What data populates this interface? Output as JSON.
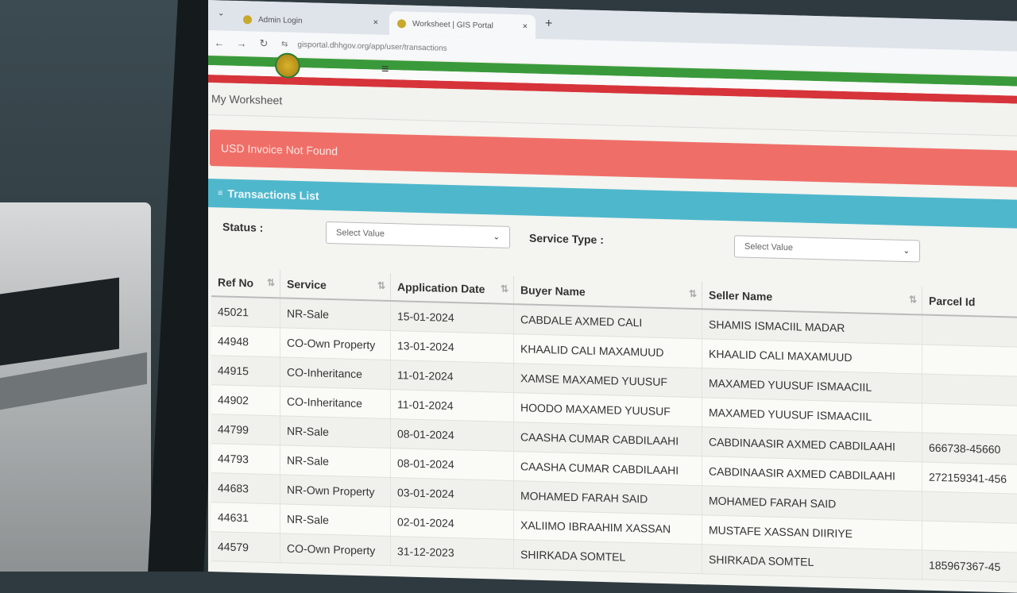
{
  "browser": {
    "tabs": [
      {
        "title": "Admin Login",
        "close": "×"
      },
      {
        "title": "Worksheet | GIS Portal",
        "close": "×"
      }
    ],
    "menu": "⌄",
    "new_tab": "+",
    "url": "gisportal.dhhgov.org/app/user/transactions",
    "nav": {
      "back": "←",
      "forward": "→",
      "reload": "↻",
      "site": "⇆"
    }
  },
  "header": {
    "menu_icon": "≡"
  },
  "page": {
    "title": "My Worksheet",
    "alert": "USD Invoice Not Found",
    "panel_title": "Transactions List",
    "panel_icon": "≡"
  },
  "filters": {
    "status_label": "Status :",
    "status_value": "Select Value",
    "service_type_label": "Service Type :",
    "service_type_value": "Select Value",
    "caret": "⌄"
  },
  "table": {
    "columns": [
      "Ref No",
      "Service",
      "Application Date",
      "Buyer Name",
      "Seller Name",
      "Parcel Id"
    ],
    "sort_icons": [
      "⇅",
      "⇅",
      "⇅",
      "⇅",
      "⇅",
      ""
    ],
    "rows": [
      [
        "45021",
        "NR-Sale",
        "15-01-2024",
        "CABDALE AXMED CALI",
        "SHAMIS ISMACIIL MADAR",
        ""
      ],
      [
        "44948",
        "CO-Own Property",
        "13-01-2024",
        "KHAALID CALI MAXAMUUD",
        "KHAALID CALI MAXAMUUD",
        ""
      ],
      [
        "44915",
        "CO-Inheritance",
        "11-01-2024",
        "XAMSE MAXAMED YUUSUF",
        "MAXAMED YUUSUF ISMAACIIL",
        ""
      ],
      [
        "44902",
        "CO-Inheritance",
        "11-01-2024",
        "HOODO MAXAMED YUUSUF",
        "MAXAMED YUUSUF ISMAACIIL",
        ""
      ],
      [
        "44799",
        "NR-Sale",
        "08-01-2024",
        "CAASHA CUMAR CABDILAAHI",
        "CABDINAASIR AXMED CABDILAAHI",
        "666738-45660"
      ],
      [
        "44793",
        "NR-Sale",
        "08-01-2024",
        "CAASHA CUMAR CABDILAAHI",
        "CABDINAASIR AXMED CABDILAAHI",
        "272159341-456"
      ],
      [
        "44683",
        "NR-Own Property",
        "03-01-2024",
        "MOHAMED FARAH SAID",
        "MOHAMED FARAH SAID",
        ""
      ],
      [
        "44631",
        "NR-Sale",
        "02-01-2024",
        "XALIIMO IBRAAHIM XASSAN",
        "MUSTAFE XASSAN DIIRIYE",
        ""
      ],
      [
        "44579",
        "CO-Own Property",
        "31-12-2023",
        "SHIRKADA SOMTEL",
        "SHIRKADA SOMTEL",
        "185967367-45"
      ]
    ]
  }
}
